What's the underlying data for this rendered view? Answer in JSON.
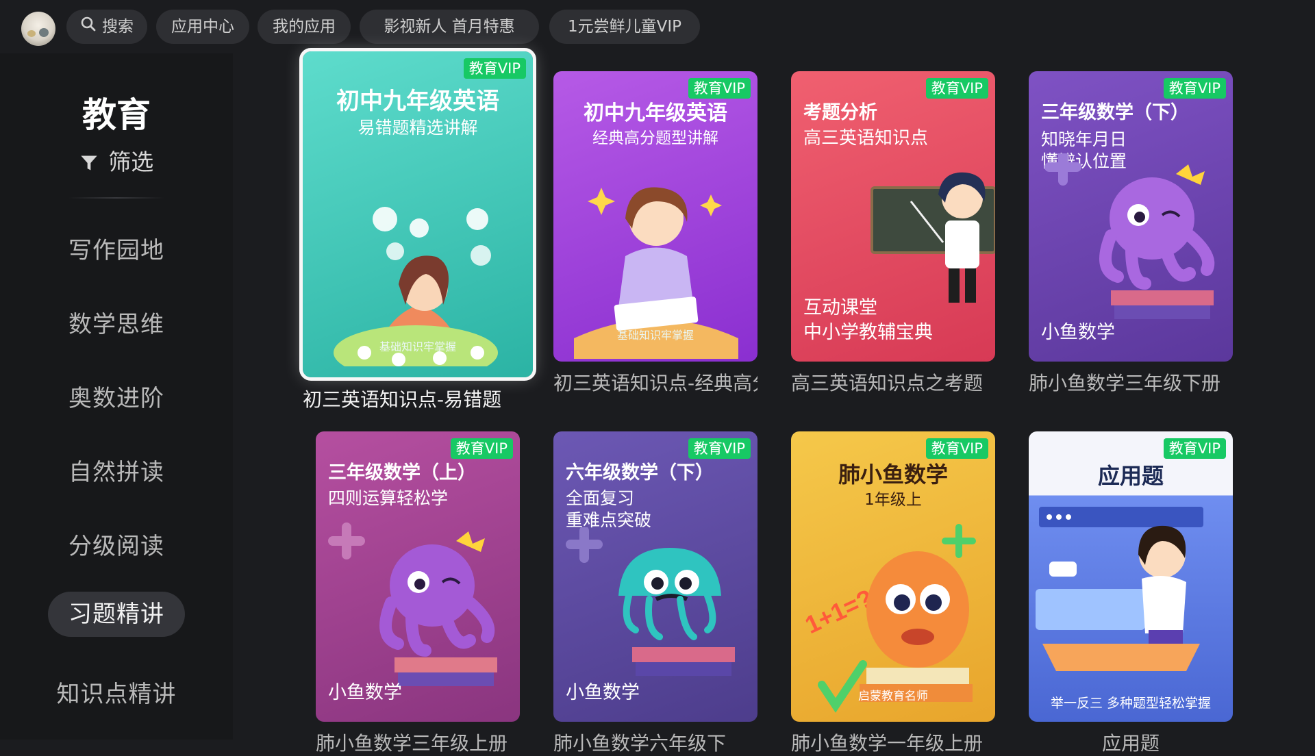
{
  "topbar": {
    "search_label": "搜索",
    "tabs": [
      "应用中心",
      "我的应用",
      "影视新人 首月特惠",
      "1元尝鲜儿童VIP"
    ]
  },
  "sidebar": {
    "category_title": "教育",
    "filter_label": "筛选",
    "items": [
      {
        "label": "写作园地"
      },
      {
        "label": "数学思维"
      },
      {
        "label": "奥数进阶"
      },
      {
        "label": "自然拼读"
      },
      {
        "label": "分级阅读"
      },
      {
        "label": "习题精讲",
        "active": true
      },
      {
        "label": "知识点精讲"
      }
    ]
  },
  "cards": [
    {
      "badge": "教育VIP",
      "title": "初中九年级英语",
      "subtitle": "易错题精选讲解",
      "bottom": "",
      "footer": "基础知识牢掌握",
      "caption": "初三英语知识点-易错题",
      "focused": true,
      "colors": [
        "#4fd3c4",
        "#2fb7a8"
      ]
    },
    {
      "badge": "教育VIP",
      "title": "初中九年级英语",
      "subtitle": "经典高分题型讲解",
      "bottom": "",
      "footer": "基础知识牢掌握",
      "caption": "初三英语知识点-经典高分题型",
      "colors": [
        "#b24fe0",
        "#8e2fd1"
      ]
    },
    {
      "badge": "教育VIP",
      "title": "考题分析",
      "subtitle": "高三英语知识点",
      "bottom": "互动课堂\n中小学教辅宝典",
      "footer": "",
      "caption": "高三英语知识点之考题",
      "colors": [
        "#ee5a6a",
        "#d93a55"
      ]
    },
    {
      "badge": "教育VIP",
      "title": "三年级数学（下）",
      "subtitle": "知晓年月日\n懂辨认位置",
      "bottom": "小鱼数学",
      "footer": "",
      "caption": "肺小鱼数学三年级下册",
      "colors": [
        "#7b4fc0",
        "#5d3aa0"
      ]
    },
    {
      "badge": "教育VIP",
      "title": "三年级数学（上）",
      "subtitle": "四则运算轻松学",
      "bottom": "小鱼数学",
      "footer": "",
      "caption": "肺小鱼数学三年级上册",
      "colors": [
        "#b04a9c",
        "#8c3782"
      ]
    },
    {
      "badge": "教育VIP",
      "title": "六年级数学（下）",
      "subtitle": "全面复习\n重难点突破",
      "bottom": "小鱼数学",
      "footer": "",
      "caption": "肺小鱼数学六年级下",
      "colors": [
        "#6a55b0",
        "#4f3f8f"
      ]
    },
    {
      "badge": "教育VIP",
      "title": "肺小鱼数学",
      "subtitle": "1年级上",
      "bottom": "",
      "footer": "启蒙教育名师",
      "caption": "肺小鱼数学一年级上册",
      "colors": [
        "#f2c23e",
        "#e5a62a"
      ]
    },
    {
      "badge": "教育VIP",
      "title": "应用题",
      "subtitle": "",
      "bottom": "",
      "footer": "举一反三 多种题型轻松掌握",
      "caption": "应用题",
      "colors": [
        "#6c8df0",
        "#4a68d6"
      ]
    }
  ]
}
